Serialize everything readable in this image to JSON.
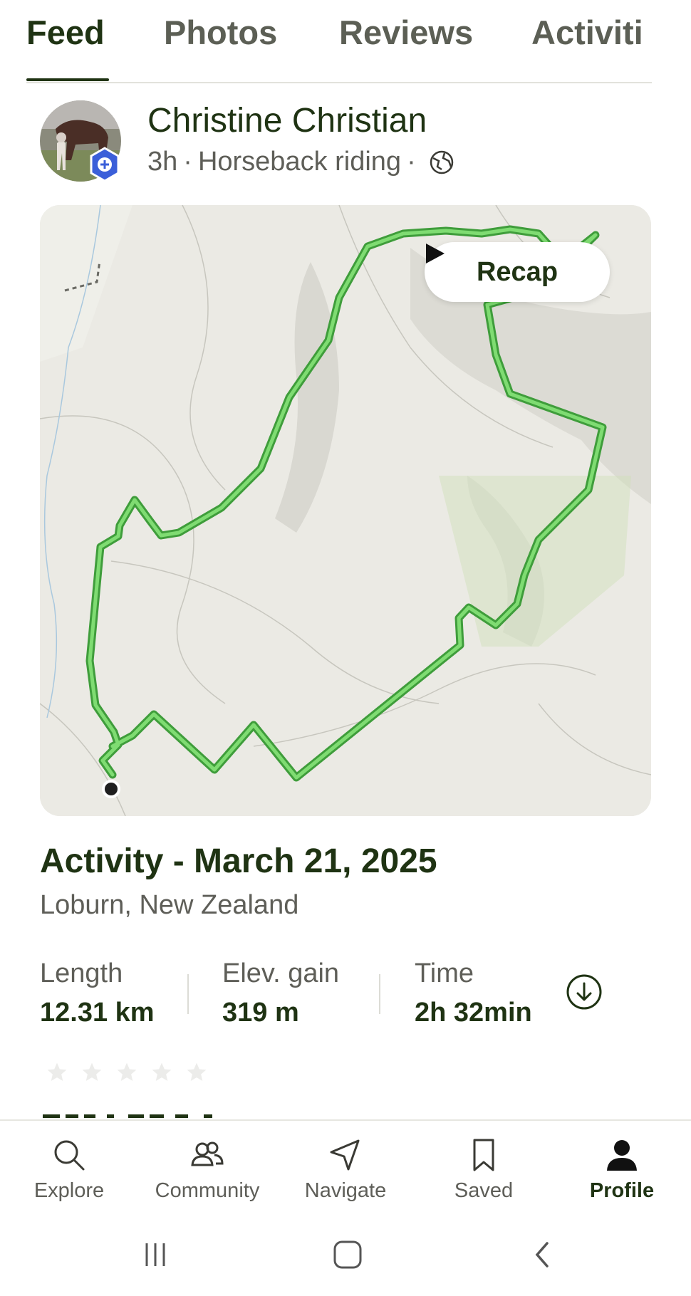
{
  "tabs": [
    {
      "label": "Feed",
      "active": true
    },
    {
      "label": "Photos",
      "active": false
    },
    {
      "label": "Reviews",
      "active": false
    },
    {
      "label": "Activiti",
      "active": false
    }
  ],
  "post": {
    "author": "Christine Christian",
    "time_ago": "3h",
    "activity_type": "Horseback riding",
    "separator": "·",
    "visibility_icon": "globe-icon",
    "badge_icon": "plus-badge-icon"
  },
  "map": {
    "recap_label": "Recap",
    "recap_icon": "play-icon",
    "route_color": "#5cc95a",
    "start_marker_color": "#1f1f1f"
  },
  "activity": {
    "title": "Activity - March 21, 2025",
    "location": "Loburn, New Zealand"
  },
  "stats": [
    {
      "label": "Length",
      "value": "12.31 km"
    },
    {
      "label": "Elev. gain",
      "value": "319 m"
    },
    {
      "label": "Time",
      "value": "2h 32min"
    }
  ],
  "download_icon": "download-icon",
  "rating": {
    "filled": 0,
    "max": 5
  },
  "bottom_nav": [
    {
      "label": "Explore",
      "icon": "search-icon",
      "active": false
    },
    {
      "label": "Community",
      "icon": "community-icon",
      "active": false
    },
    {
      "label": "Navigate",
      "icon": "navigate-icon",
      "active": false
    },
    {
      "label": "Saved",
      "icon": "bookmark-icon",
      "active": false
    },
    {
      "label": "Profile",
      "icon": "profile-icon",
      "active": true
    }
  ],
  "colors": {
    "primary_text": "#1f3313",
    "secondary_text": "#5e5e58",
    "accent_route": "#5cc95a"
  }
}
